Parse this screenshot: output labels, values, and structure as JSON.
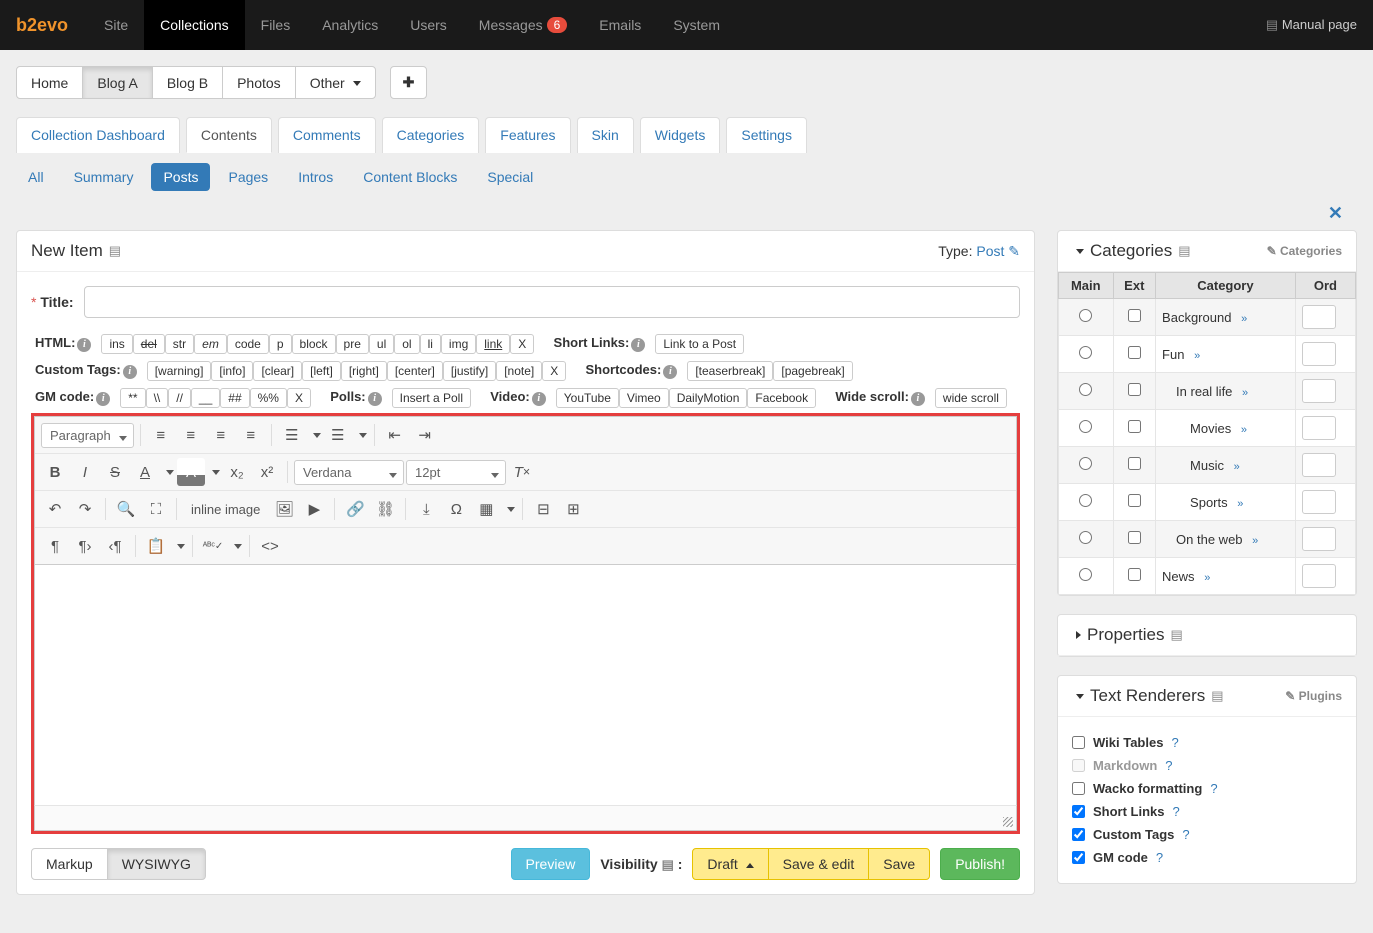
{
  "brand": "b2evo",
  "navbar": {
    "items": [
      "Site",
      "Collections",
      "Files",
      "Analytics",
      "Users",
      "Messages",
      "Emails",
      "System"
    ],
    "active": "Collections",
    "messages_badge": "6",
    "manual": "Manual page"
  },
  "collections": {
    "items": [
      "Home",
      "Blog A",
      "Blog B",
      "Photos",
      "Other"
    ],
    "active": "Blog A"
  },
  "tabs": {
    "items": [
      "Collection Dashboard",
      "Contents",
      "Comments",
      "Categories",
      "Features",
      "Skin",
      "Widgets",
      "Settings"
    ],
    "active": "Contents"
  },
  "subnav": {
    "items": [
      "All",
      "Summary",
      "Posts",
      "Pages",
      "Intros",
      "Content Blocks",
      "Special"
    ],
    "active": "Posts"
  },
  "editor_panel": {
    "title": "New Item",
    "type_label": "Type:",
    "type_value": "Post",
    "title_label": "Title:"
  },
  "toolbars": {
    "html": {
      "label": "HTML:",
      "buttons": [
        "ins",
        "del",
        "str",
        "em",
        "code",
        "p",
        "block",
        "pre",
        "ul",
        "ol",
        "li",
        "img",
        "link",
        "X"
      ]
    },
    "shortlinks": {
      "label": "Short Links:",
      "buttons": [
        "Link to a Post"
      ]
    },
    "customtags": {
      "label": "Custom Tags:",
      "buttons": [
        "[warning]",
        "[info]",
        "[clear]",
        "[left]",
        "[right]",
        "[center]",
        "[justify]",
        "[note]",
        "X"
      ]
    },
    "shortcodes": {
      "label": "Shortcodes:",
      "buttons": [
        "[teaserbreak]",
        "[pagebreak]"
      ]
    },
    "gmcode": {
      "label": "GM code:",
      "buttons": [
        "**",
        "\\\\",
        "//",
        "__",
        "##",
        "%%",
        "X"
      ]
    },
    "polls": {
      "label": "Polls:",
      "buttons": [
        "Insert a Poll"
      ]
    },
    "video": {
      "label": "Video:",
      "buttons": [
        "YouTube",
        "Vimeo",
        "DailyMotion",
        "Facebook"
      ]
    },
    "widescroll": {
      "label": "Wide scroll:",
      "buttons": [
        "wide scroll"
      ]
    }
  },
  "editbar": {
    "block_format": "Paragraph",
    "font_family": "Verdana",
    "font_size": "12pt",
    "inline_image": "inline image"
  },
  "bottom": {
    "markup": "Markup",
    "wysiwyg": "WYSIWYG",
    "preview": "Preview",
    "visibility": "Visibility",
    "draft": "Draft",
    "save_edit": "Save & edit",
    "save": "Save",
    "publish": "Publish!"
  },
  "categories_panel": {
    "title": "Categories",
    "link": "Categories",
    "headers": {
      "main": "Main",
      "ext": "Ext",
      "category": "Category",
      "ord": "Ord"
    },
    "rows": [
      {
        "indent": 0,
        "name": "Background"
      },
      {
        "indent": 0,
        "name": "Fun"
      },
      {
        "indent": 1,
        "name": "In real life"
      },
      {
        "indent": 2,
        "name": "Movies"
      },
      {
        "indent": 2,
        "name": "Music"
      },
      {
        "indent": 2,
        "name": "Sports"
      },
      {
        "indent": 1,
        "name": "On the web"
      },
      {
        "indent": 0,
        "name": "News"
      }
    ]
  },
  "properties_panel": {
    "title": "Properties"
  },
  "renderers_panel": {
    "title": "Text Renderers",
    "link": "Plugins",
    "items": [
      {
        "label": "Wiki Tables",
        "checked": false,
        "disabled": false
      },
      {
        "label": "Markdown",
        "checked": false,
        "disabled": true
      },
      {
        "label": "Wacko formatting",
        "checked": false,
        "disabled": false
      },
      {
        "label": "Short Links",
        "checked": true,
        "disabled": false
      },
      {
        "label": "Custom Tags",
        "checked": true,
        "disabled": false
      },
      {
        "label": "GM code",
        "checked": true,
        "disabled": false
      }
    ]
  }
}
